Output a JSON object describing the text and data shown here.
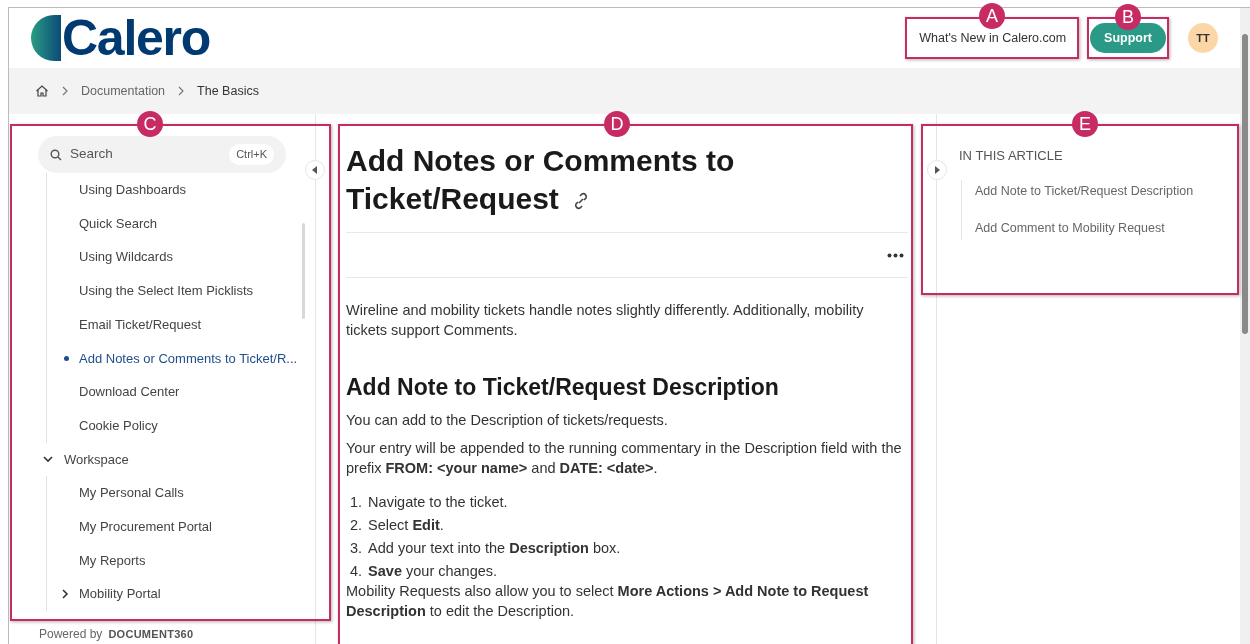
{
  "header": {
    "logo": "Calero",
    "whats_new": "What's New in Calero.com",
    "support_button": "Support",
    "avatar": "TT"
  },
  "breadcrumb": [
    "Documentation",
    "The Basics"
  ],
  "sidebar": {
    "search": {
      "placeholder": "Search",
      "shortcut": "Ctrl+K"
    },
    "items": [
      {
        "children": [
          {
            "label": "Using Dashboards",
            "selected": false
          },
          {
            "label": "Quick Search",
            "selected": false
          },
          {
            "label": "Using Wildcards",
            "selected": false
          },
          {
            "label": "Using the Select Item Picklists",
            "selected": false
          },
          {
            "label": "Email Ticket/Request",
            "selected": false
          },
          {
            "label": "Add Notes or Comments to Ticket/R...",
            "selected": true
          },
          {
            "label": "Download Center",
            "selected": false
          },
          {
            "label": "Cookie Policy",
            "selected": false
          }
        ]
      },
      {
        "label": "Workspace",
        "selected": false,
        "expanded": true,
        "children": [
          {
            "label": "My Personal Calls",
            "selected": false
          },
          {
            "label": "My Procurement Portal",
            "selected": false
          },
          {
            "label": "My Reports",
            "selected": false
          },
          {
            "label": "Mobility Portal",
            "selected": false,
            "expanded": false
          }
        ]
      }
    ],
    "powered_by": "Powered by",
    "powered_brand": "DOCUMENT360"
  },
  "article": {
    "title": "Add Notes or Comments to Ticket/Request",
    "intro": "Wireline and mobility tickets handle notes slightly differently. Additionally, mobility tickets support Comments.",
    "section_title": "Add Note to Ticket/Request Description",
    "paragraphs": [
      "You can add to the Description of tickets/requests.",
      "Your entry will be appended to the running commentary in the Description field with the prefix **FROM: <your name>** and **DATE: <date>**."
    ],
    "steps": [
      {
        "number": "1.",
        "text": "Navigate to the ticket."
      },
      {
        "number": "2.",
        "text": "Select **Edit**."
      },
      {
        "number": "3.",
        "text": "Add your text into the **Description** box."
      },
      {
        "number": "4.",
        "text": "**Save** your changes."
      }
    ],
    "closing": "Mobility Requests also allow you to select **More Actions > Add Note to Request Description** to edit the Description."
  },
  "toc": {
    "heading": "IN THIS ARTICLE",
    "items": [
      "Add Note to Ticket/Request Description",
      "Add Comment to Mobility Request"
    ]
  },
  "annotations": [
    {
      "label": "A"
    },
    {
      "label": "B"
    },
    {
      "label": "C"
    },
    {
      "label": "D"
    },
    {
      "label": "E"
    }
  ]
}
